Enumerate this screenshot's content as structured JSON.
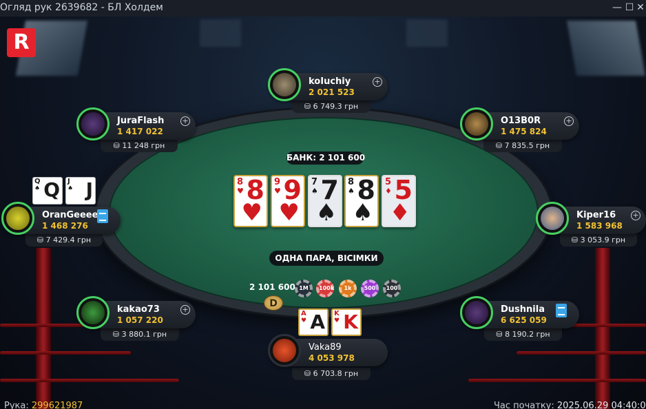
{
  "window": {
    "title": "Огляд рук 2639682 - БЛ Холдем",
    "minimize": "—",
    "maximize": "☐",
    "close": "✕"
  },
  "logo": {
    "letter": "R",
    "color": "#e5232d"
  },
  "pot": {
    "label": "БАНК: 2 101 600"
  },
  "board": [
    {
      "rank": "8",
      "suit": "♥",
      "color": "red"
    },
    {
      "rank": "9",
      "suit": "♥",
      "color": "red"
    },
    {
      "rank": "7",
      "suit": "♠",
      "color": "black"
    },
    {
      "rank": "8",
      "suit": "♠",
      "color": "black"
    },
    {
      "rank": "5",
      "suit": "♦",
      "color": "red"
    }
  ],
  "hand_result": "ОДНА ПАРА, ВІСІМКИ",
  "bet": {
    "amount": "2 101 600",
    "chips": [
      "1M",
      "100k",
      "1k",
      "500",
      "100"
    ],
    "chip_colors": [
      "#26303a",
      "#d63b3b",
      "#e07a1c",
      "#9d3ad1",
      "#2b2f35"
    ]
  },
  "dealer_button": "D",
  "players": [
    {
      "name": "koIuchiy",
      "stack": "2 021 523",
      "winnings": "6 749.3 грн"
    },
    {
      "name": "JuraFlash",
      "stack": "1 417 022",
      "winnings": "11 248 грн"
    },
    {
      "name": "O13B0R",
      "stack": "1 475 824",
      "winnings": "7 835.5 грн"
    },
    {
      "name": "OranGeeee",
      "stack": "1 468 276",
      "winnings": "7 429.4 грн",
      "cards": [
        {
          "rank": "Q",
          "suit": "♠"
        },
        {
          "rank": "J",
          "suit": "♠"
        }
      ]
    },
    {
      "name": "Kiper16",
      "stack": "1 583 968",
      "winnings": "3 053.9 грн"
    },
    {
      "name": "kakao73",
      "stack": "1 057 220",
      "winnings": "3 880.1 грн"
    },
    {
      "name": "Dushnila",
      "stack": "6 625 059",
      "winnings": "8 190.2 грн"
    },
    {
      "name": "Vaka89",
      "stack": "4 053 978",
      "winnings": "6 703.8 грн",
      "cards": [
        {
          "rank": "A",
          "suit": "♥"
        },
        {
          "rank": "K",
          "suit": "♥"
        }
      ]
    }
  ],
  "footer": {
    "hand_label": "Рука:",
    "hand_id": "299621987",
    "start_label": "Час початку:",
    "start_time": "2025.06.29 04:40:00"
  },
  "icons": {
    "plus": "+",
    "wallet": "⛁",
    "note": "note-icon"
  }
}
